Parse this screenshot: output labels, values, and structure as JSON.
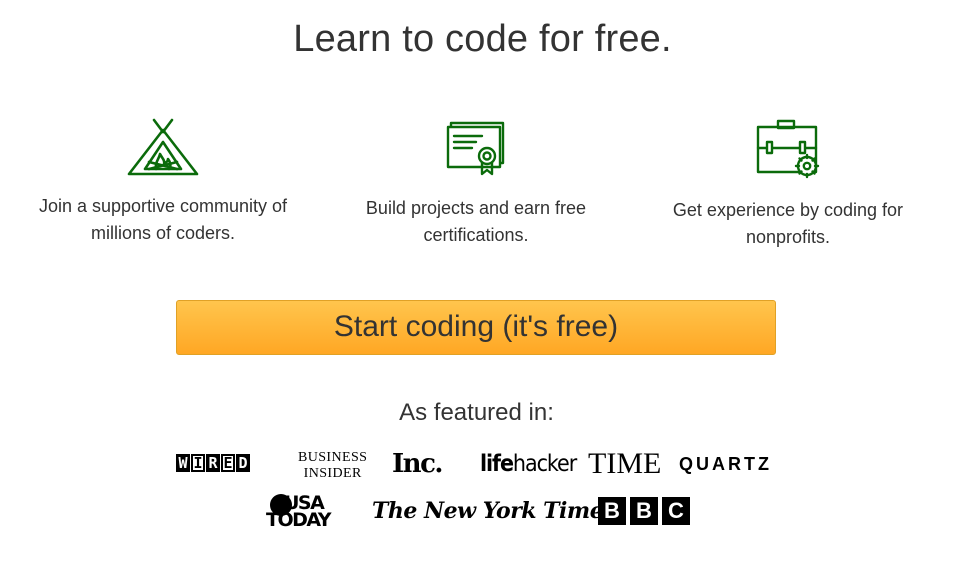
{
  "title": "Learn to code for free.",
  "features": [
    {
      "icon": "campfire-tent-icon",
      "text": "Join a supportive community of millions of coders."
    },
    {
      "icon": "certificate-icon",
      "text": "Build projects and earn free certifications."
    },
    {
      "icon": "briefcase-icon",
      "text": "Get experience by coding for nonprofits."
    }
  ],
  "cta_label": "Start coding (it's free)",
  "featured_label": "As featured in:",
  "logos": {
    "wired": [
      "W",
      "I",
      "R",
      "E",
      "D"
    ],
    "business_insider_line1": "BUSINESS",
    "business_insider_line2": "INSIDER",
    "inc": "Inc.",
    "lifehacker_a": "life",
    "lifehacker_b": "hacker",
    "time": "TIME",
    "quartz": "QUARTZ",
    "usa_today_line1": "USA",
    "usa_today_line2": "TODAY",
    "nyt": "The New York Times",
    "bbc": [
      "B",
      "B",
      "C"
    ]
  },
  "colors": {
    "icon_green": "#0b6b0b",
    "cta_top": "#ffc54d",
    "cta_bottom": "#ffa724",
    "text": "#333333"
  }
}
